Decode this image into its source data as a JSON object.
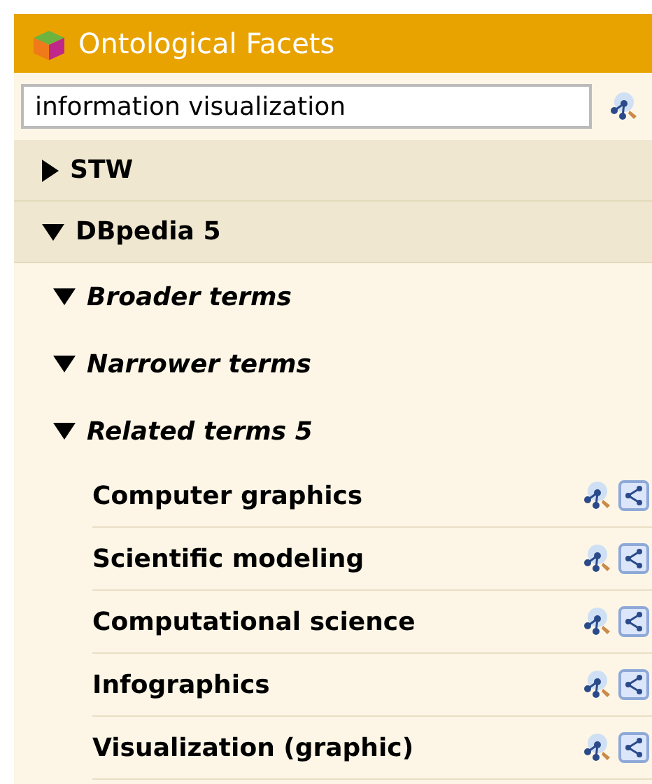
{
  "header": {
    "title": "Ontological Facets"
  },
  "search": {
    "value": "information visualization"
  },
  "facets": [
    {
      "label": "STW",
      "expanded": false
    },
    {
      "label": "DBpedia 5",
      "expanded": true,
      "children": [
        {
          "label": "Broader terms",
          "expanded": true
        },
        {
          "label": "Narrower terms",
          "expanded": true
        },
        {
          "label": "Related terms 5",
          "expanded": true,
          "children": [
            {
              "label": "Computer graphics"
            },
            {
              "label": "Scientific modeling"
            },
            {
              "label": "Computational science"
            },
            {
              "label": "Infographics"
            },
            {
              "label": "Visualization (graphic)"
            }
          ]
        }
      ]
    }
  ]
}
